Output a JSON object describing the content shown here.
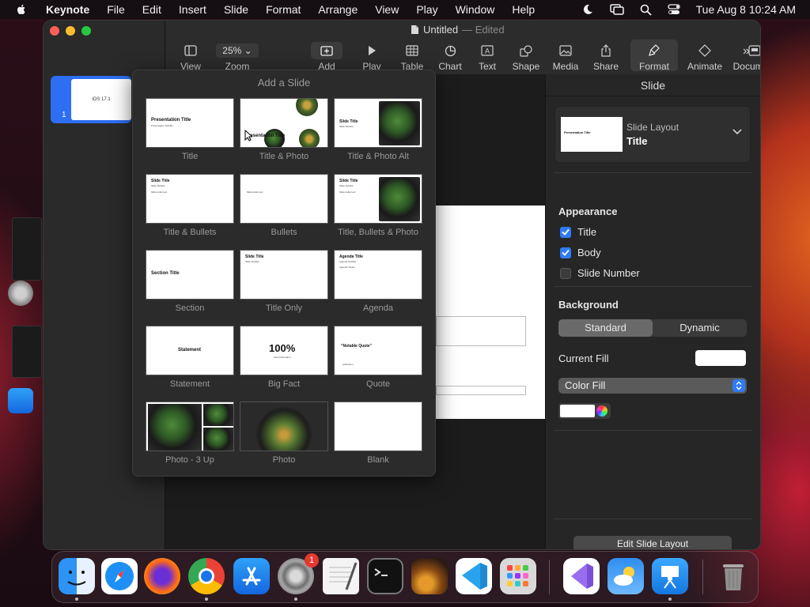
{
  "menubar": {
    "app": "Keynote",
    "items": [
      "File",
      "Edit",
      "Insert",
      "Slide",
      "Format",
      "Arrange",
      "View",
      "Play",
      "Window",
      "Help"
    ],
    "datetime": "Tue Aug 8  10:24 AM"
  },
  "window": {
    "doc_title": "Untitled",
    "doc_status": "Edited",
    "toolbar": {
      "zoom_value": "25%",
      "view": "View",
      "zoom": "Zoom",
      "add_slide": "Add Slide",
      "play": "Play",
      "table": "Table",
      "chart": "Chart",
      "text": "Text",
      "shape": "Shape",
      "media": "Media",
      "share": "Share",
      "format": "Format",
      "animate": "Animate",
      "document": "Document"
    }
  },
  "navigator": {
    "slide_number": "1",
    "slide_text": "iOS 17.1"
  },
  "popover": {
    "title": "Add a Slide",
    "layouts": [
      {
        "label": "Title"
      },
      {
        "label": "Title & Photo"
      },
      {
        "label": "Title & Photo Alt"
      },
      {
        "label": "Title & Bullets"
      },
      {
        "label": "Bullets"
      },
      {
        "label": "Title, Bullets & Photo"
      },
      {
        "label": "Section"
      },
      {
        "label": "Title Only"
      },
      {
        "label": "Agenda"
      },
      {
        "label": "Statement"
      },
      {
        "label": "Big Fact"
      },
      {
        "label": "Quote"
      },
      {
        "label": "Photo - 3 Up"
      },
      {
        "label": "Photo"
      },
      {
        "label": "Blank"
      }
    ],
    "preview_text": {
      "presentation_title": "Presentation Title",
      "presentation_subtitle": "Presentation Subtitle",
      "slide_title": "Slide Title",
      "slide_subtitle": "Slide Subtitle",
      "bullet": "Slide bullet text",
      "section_title": "Section Title",
      "agenda_title": "Agenda Title",
      "agenda_subtitle": "Agenda Subtitle",
      "agenda_topics": "Agenda Topics",
      "statement": "Statement",
      "big_fact": "100%",
      "fact_info": "Fact information",
      "quote": "“Notable Quote”",
      "attribution": "Attribution"
    }
  },
  "inspector": {
    "tab": "Slide",
    "layout_label": "Slide Layout",
    "layout_name": "Title",
    "layout_preview_title": "Presentation Title",
    "appearance": "Appearance",
    "checkboxes": [
      {
        "label": "Title",
        "checked": true
      },
      {
        "label": "Body",
        "checked": true
      },
      {
        "label": "Slide Number",
        "checked": false
      }
    ],
    "background": "Background",
    "segments": [
      "Standard",
      "Dynamic"
    ],
    "selected_segment": "Standard",
    "current_fill": "Current Fill",
    "fill_type": "Color Fill",
    "edit_layout_button": "Edit Slide Layout"
  },
  "dock": {
    "apps": [
      "Finder",
      "Safari",
      "Firefox",
      "Chrome",
      "App Store",
      "System Settings",
      "TextEdit",
      "Terminal",
      "GarageBand",
      "Visual Studio Code",
      "Launchpad",
      "Visual Studio",
      "Weather",
      "Keynote",
      "Trash"
    ],
    "settings_badge": "1"
  },
  "colors": {
    "accent": "#2f7bf5",
    "badge": "#e5382e",
    "selection": "#2d6ef2"
  }
}
